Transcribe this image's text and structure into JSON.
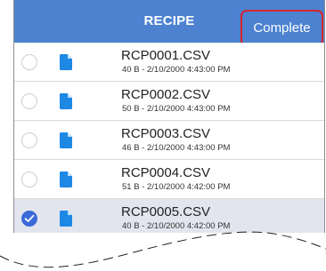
{
  "header": {
    "title": "RECIPE",
    "complete_label": "Complete"
  },
  "colors": {
    "header_bg": "#4c82d0",
    "highlight_border": "#d8262c",
    "selected_row_bg": "#e2e5ee",
    "checked_radio": "#3a6ad8",
    "file_icon": "#1e88e5"
  },
  "files": [
    {
      "name": "RCP0001.CSV",
      "meta": "40 B - 2/10/2000 4:43:00 PM",
      "selected": false
    },
    {
      "name": "RCP0002.CSV",
      "meta": "50 B - 2/10/2000 4:43:00 PM",
      "selected": false
    },
    {
      "name": "RCP0003.CSV",
      "meta": "46 B - 2/10/2000 4:43:00 PM",
      "selected": false
    },
    {
      "name": "RCP0004.CSV",
      "meta": "51 B - 2/10/2000 4:42:00 PM",
      "selected": false
    },
    {
      "name": "RCP0005.CSV",
      "meta": "40 B - 2/10/2000 4:42:00 PM",
      "selected": true
    }
  ],
  "icons": {
    "radio": "radio-circle-icon",
    "checked": "checkmark-icon",
    "file": "file-icon"
  }
}
